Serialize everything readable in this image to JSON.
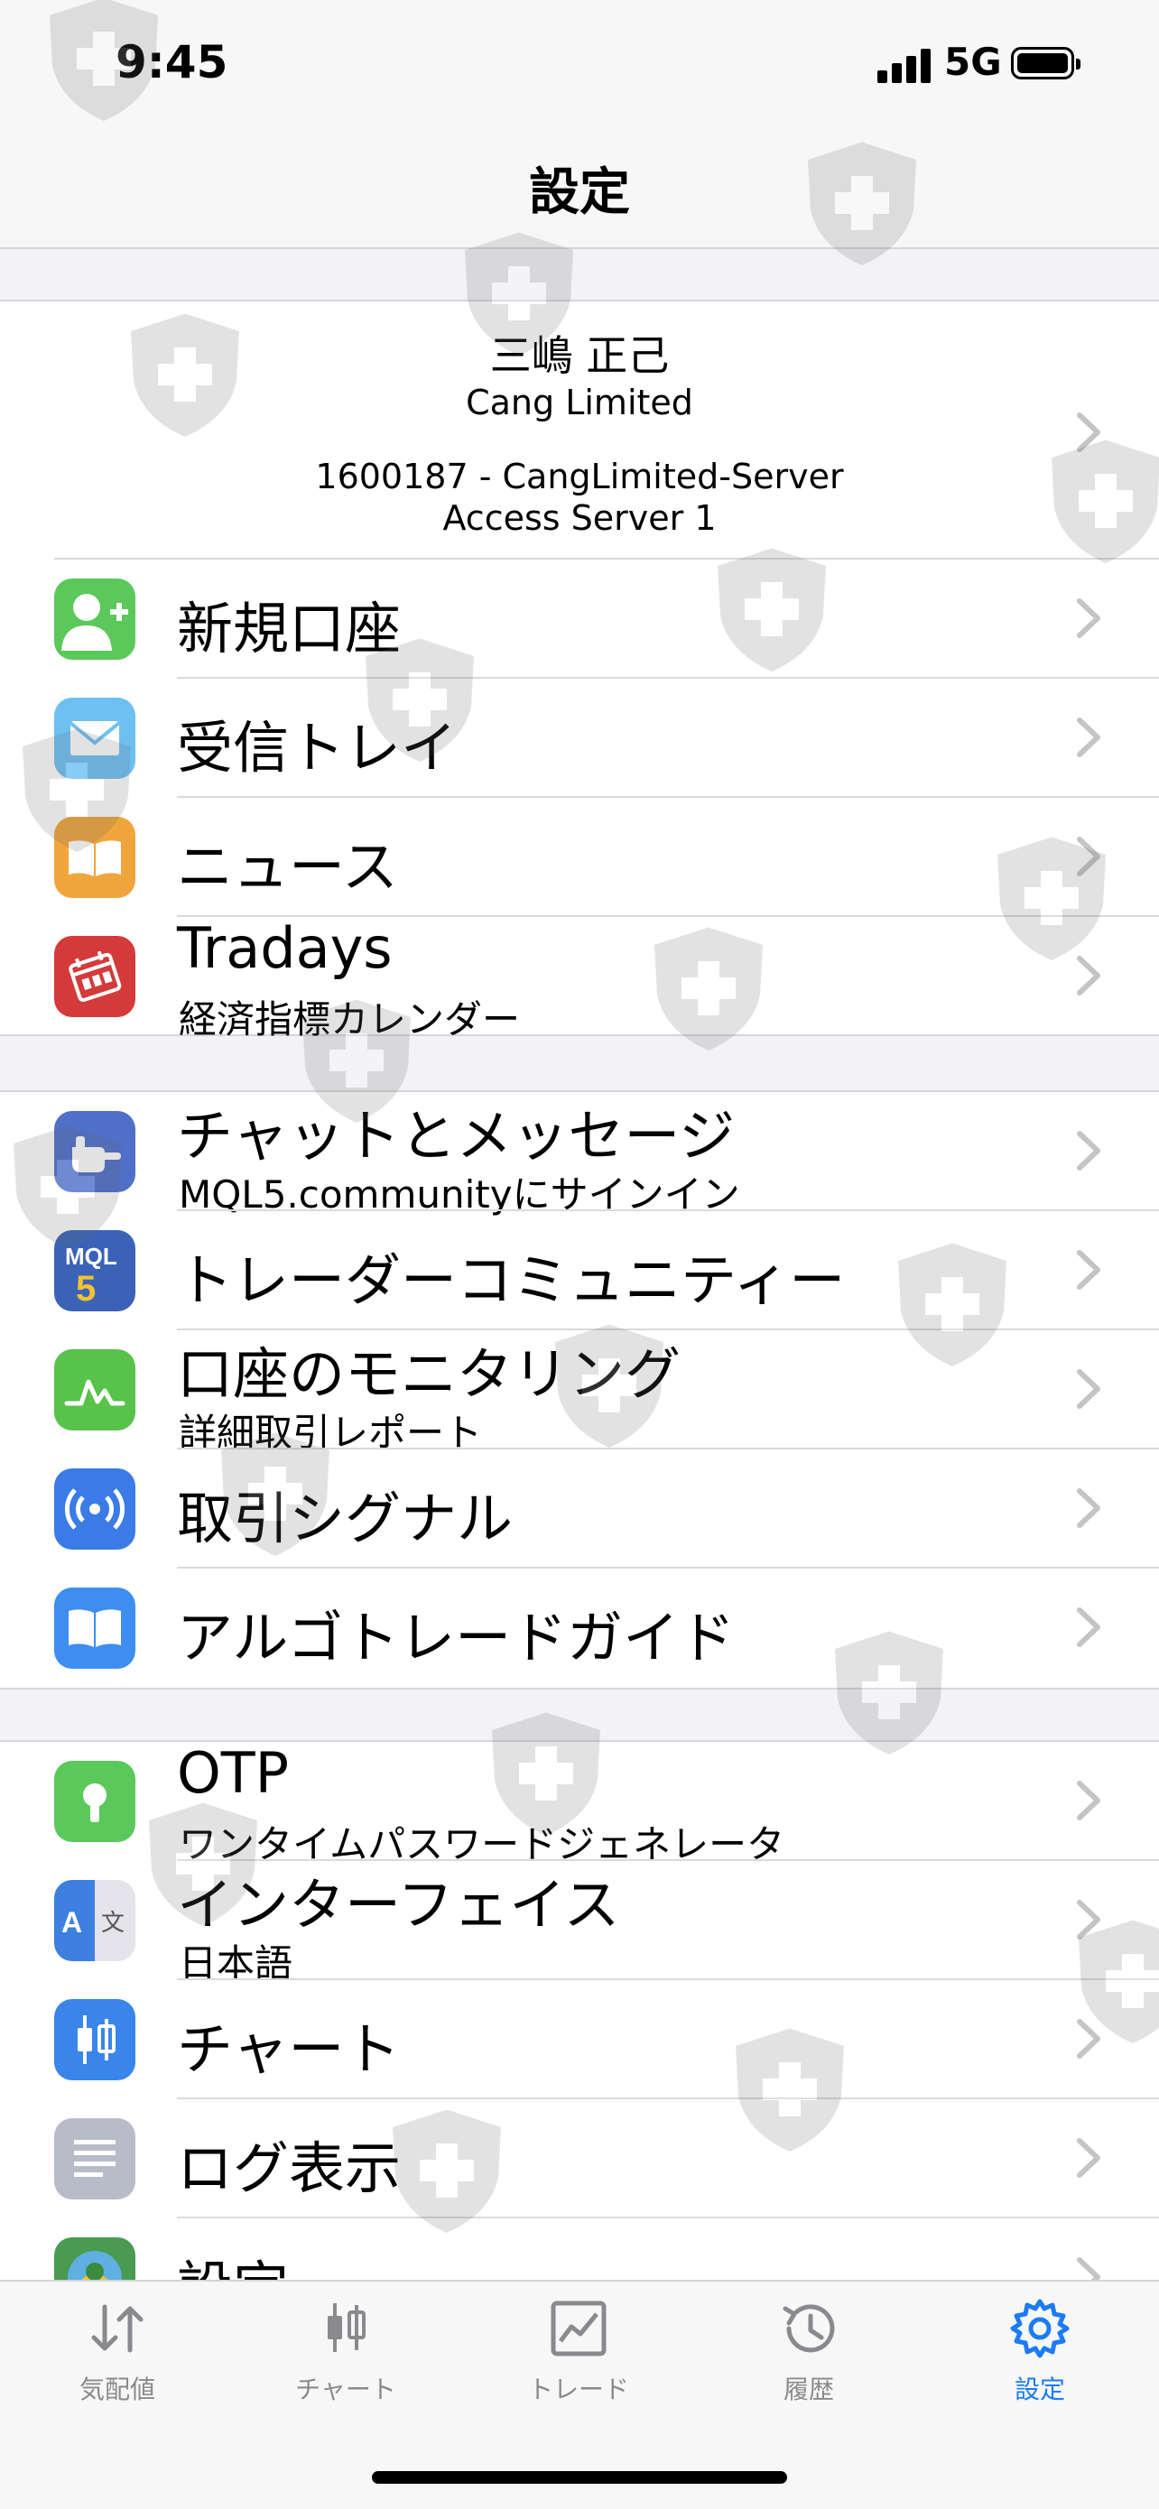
{
  "status_bar": {
    "time": "9:45",
    "network": "5G"
  },
  "nav": {
    "title": "設定"
  },
  "account": {
    "name": "三嶋 正己",
    "company": "Cang Limited",
    "server": "1600187 - CangLimited-Server",
    "access": "Access Server 1"
  },
  "section1": [
    {
      "label": "新規口座",
      "icon": "add-user-icon",
      "color": "#5ac85a"
    },
    {
      "label": "受信トレイ",
      "icon": "mail-icon",
      "color": "#6fc0f2"
    },
    {
      "label": "ニュース",
      "icon": "book-icon",
      "color": "#f0a53c"
    },
    {
      "label": "Tradays",
      "sub": "経済指標カレンダー",
      "icon": "calendar-icon",
      "color": "#d43a3a"
    }
  ],
  "section2": [
    {
      "label": "チャットとメッセージ",
      "sub": "MQL5.communityにサインイン",
      "icon": "chat-hand-icon",
      "color": "#4f6fc8"
    },
    {
      "label": "トレーダーコミュニティー",
      "icon": "mql5-icon",
      "color": "#3a63b8"
    },
    {
      "label": "口座のモニタリング",
      "sub": "詳細取引レポート",
      "icon": "monitoring-icon",
      "color": "#58c24a"
    },
    {
      "label": "取引シグナル",
      "icon": "signal-icon",
      "color": "#3a7be8"
    },
    {
      "label": "アルゴトレードガイド",
      "icon": "guide-book-icon",
      "color": "#3d8ef0"
    }
  ],
  "section3": [
    {
      "label": "OTP",
      "sub": "ワンタイムパスワードジェネレータ",
      "icon": "keyhole-icon",
      "color": "#5ac85a"
    },
    {
      "label": "インターフェイス",
      "sub": "日本語",
      "icon": "language-icon",
      "color": "#3d80e0"
    },
    {
      "label": "チャート",
      "icon": "candlestick-icon",
      "color": "#3a85ea"
    },
    {
      "label": "ログ表示",
      "icon": "log-icon",
      "color": "#b8bcc8"
    },
    {
      "label": "設定",
      "icon": "metatrader-icon",
      "color": "#4a9a52"
    }
  ],
  "tabbar": [
    {
      "label": "気配値",
      "icon": "quotes-icon"
    },
    {
      "label": "チャート",
      "icon": "chart-tab-icon"
    },
    {
      "label": "トレード",
      "icon": "trade-icon"
    },
    {
      "label": "履歴",
      "icon": "history-icon"
    },
    {
      "label": "設定",
      "icon": "settings-gear-icon",
      "active": true
    }
  ],
  "colors": {
    "accent": "#1b7cf3",
    "tab_inactive": "#8a8a8e",
    "chevron": "#c4c4c7"
  }
}
